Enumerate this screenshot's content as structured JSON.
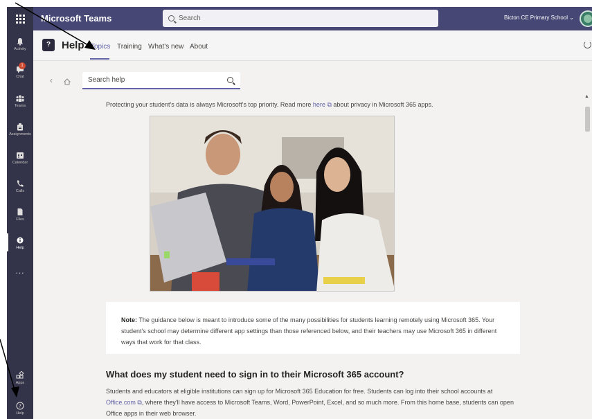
{
  "app": {
    "title": "Microsoft Teams",
    "org": "Bicton CE Primary School ⌄"
  },
  "search": {
    "placeholder": "Search"
  },
  "rail": {
    "items": [
      {
        "label": "Activity"
      },
      {
        "label": "Chat",
        "badge": "1"
      },
      {
        "label": "Teams"
      },
      {
        "label": "Assignments"
      },
      {
        "label": "Calendar"
      },
      {
        "label": "Calls"
      },
      {
        "label": "Files"
      },
      {
        "label": "Help"
      },
      {
        "label": "..."
      }
    ],
    "bottom": [
      {
        "label": "Apps"
      },
      {
        "label": "Help"
      }
    ]
  },
  "help": {
    "title": "Help",
    "logo": "?",
    "tabs": [
      "Topics",
      "Training",
      "What's new",
      "About"
    ],
    "active_tab": "Topics",
    "search_placeholder": "Search help"
  },
  "content": {
    "privacy_text": "Protecting your student's data is always Microsoft's top priority. Read more",
    "privacy_link": "here",
    "privacy_tail": "about privacy in Microsoft 365 apps.",
    "note_label": "Note:",
    "note_text": "The guidance below is meant to introduce some of the many possibilities for students learning remotely using Microsoft 365. Your student's school may determine different app settings than those referenced below, and their teachers may use Microsoft 365 in different ways that work for that class.",
    "section_title": "What does my student need to sign in to their Microsoft 365 account?",
    "para_1": "Students and educators at eligible institutions can sign up for Microsoft 365 Education for free. Students can log into their school accounts at",
    "para_link": "Office.com",
    "para_2": ", where they'll have access to Microsoft Teams, Word, PowerPoint, Excel, and so much more. From this home base, students can open Office apps in their web browser."
  },
  "colors": {
    "brand": "#464775",
    "rail": "#33344a",
    "accent": "#6264a7",
    "badge": "#cc4a31"
  }
}
